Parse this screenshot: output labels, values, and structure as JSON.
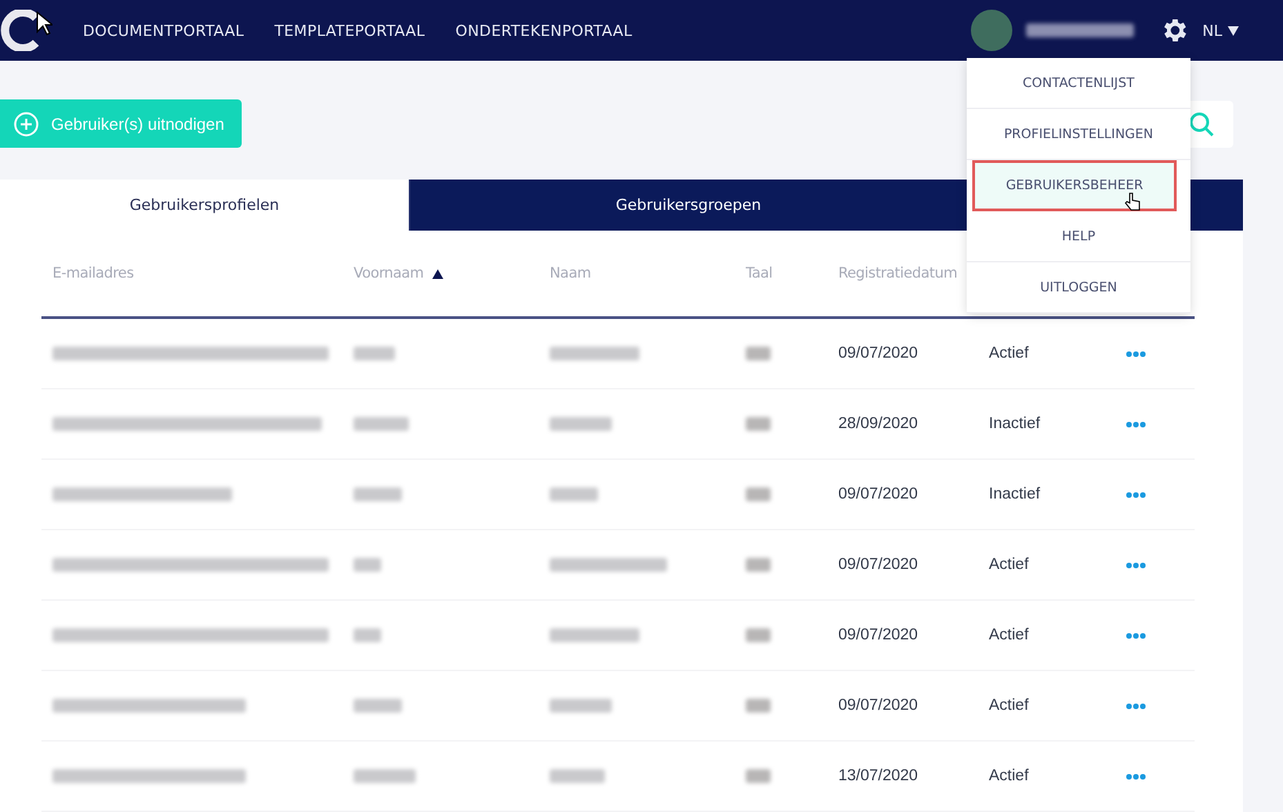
{
  "nav": {
    "links": [
      {
        "label": "DOCUMENTPORTAAL"
      },
      {
        "label": "TEMPLATEPORTAAL"
      },
      {
        "label": "ONDERTEKENPORTAAL"
      }
    ],
    "language": "NL"
  },
  "invite_button": {
    "label": "Gebruiker(s) uitnodigen"
  },
  "tabs": [
    {
      "label": "Gebruikersprofielen",
      "selected": true
    },
    {
      "label": "Gebruikersgroepen",
      "selected": false
    }
  ],
  "table": {
    "columns": [
      {
        "label": "E-mailadres",
        "sorted": false
      },
      {
        "label": "Voornaam",
        "sorted": true
      },
      {
        "label": "Naam",
        "sorted": false
      },
      {
        "label": "Taal",
        "sorted": false
      },
      {
        "label": "Registratiedatum",
        "sorted": false
      }
    ],
    "rows": [
      {
        "date": "09/07/2020",
        "status": "Actief"
      },
      {
        "date": "28/09/2020",
        "status": "Inactief"
      },
      {
        "date": "09/07/2020",
        "status": "Inactief"
      },
      {
        "date": "09/07/2020",
        "status": "Actief"
      },
      {
        "date": "09/07/2020",
        "status": "Actief"
      },
      {
        "date": "09/07/2020",
        "status": "Actief"
      },
      {
        "date": "13/07/2020",
        "status": "Actief"
      }
    ]
  },
  "user_menu": {
    "items": [
      {
        "label": "CONTACTENLIJST",
        "selected": false
      },
      {
        "label": "PROFIELINSTELLINGEN",
        "selected": false
      },
      {
        "label": "GEBRUIKERSBEHEER",
        "selected": true
      },
      {
        "label": "HELP",
        "selected": false
      },
      {
        "label": "UITLOGGEN",
        "selected": false
      }
    ]
  }
}
